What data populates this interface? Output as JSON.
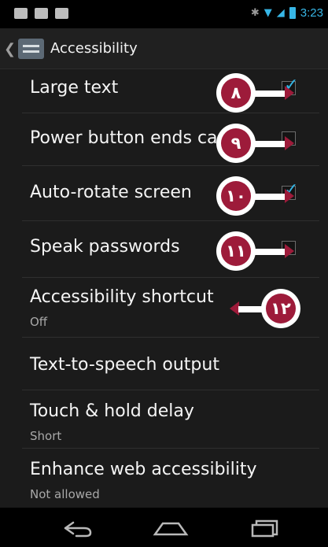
{
  "status": {
    "time": "3:23"
  },
  "header": {
    "title": "Accessibility"
  },
  "settings": [
    {
      "title": "Large text",
      "checked": true,
      "callout": "٨"
    },
    {
      "title": "Power button ends ca",
      "checked": false,
      "callout": "٩"
    },
    {
      "title": "Auto-rotate screen",
      "checked": true,
      "callout": "١٠"
    },
    {
      "title": "Speak passwords",
      "checked": false,
      "callout": "١١"
    },
    {
      "title": "Accessibility shortcut",
      "subtitle": "Off",
      "callout": "١٢"
    },
    {
      "title": "Text-to-speech output"
    },
    {
      "title": "Touch & hold delay",
      "subtitle": "Short"
    },
    {
      "title": "Enhance web accessibility",
      "subtitle": "Not allowed"
    }
  ],
  "icons": {
    "back": "back-icon",
    "home": "home-icon",
    "recents": "recent-apps-icon",
    "chevron": "chevron-left-icon",
    "app": "accessibility-settings-icon"
  },
  "colors": {
    "accent": "#33b5e5",
    "callout": "#9d1b3a"
  }
}
